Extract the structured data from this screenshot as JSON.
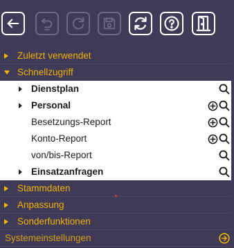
{
  "toolbar": {
    "buttons": [
      {
        "name": "back",
        "icon": "arrow-left-icon",
        "enabled": true
      },
      {
        "name": "undo",
        "icon": "undo-icon",
        "enabled": false
      },
      {
        "name": "redo",
        "icon": "redo-icon",
        "enabled": false
      },
      {
        "name": "save",
        "icon": "save-icon",
        "enabled": false
      },
      {
        "name": "refresh",
        "icon": "refresh-icon",
        "enabled": true
      },
      {
        "name": "help",
        "icon": "help-icon",
        "enabled": true
      },
      {
        "name": "exit",
        "icon": "exit-door-icon",
        "enabled": true
      }
    ]
  },
  "menu": {
    "recent": {
      "label": "Zuletzt verwendet",
      "expanded": false
    },
    "quick": {
      "label": "Schnellzugriff",
      "expanded": true,
      "items": [
        {
          "label": "Dienstplan",
          "has_children": true,
          "actions": [
            "search-icon"
          ]
        },
        {
          "label": "Personal",
          "has_children": true,
          "actions": [
            "add-circle-icon",
            "search-icon"
          ]
        },
        {
          "label": "Besetzungs-Report",
          "has_children": false,
          "actions": [
            "add-circle-icon",
            "search-icon"
          ]
        },
        {
          "label": "Konto-Report",
          "has_children": false,
          "actions": [
            "add-circle-icon",
            "search-icon"
          ]
        },
        {
          "label": "von/bis-Report",
          "has_children": false,
          "actions": [
            "search-icon"
          ]
        },
        {
          "label": "Einsatzanfragen",
          "has_children": true,
          "actions": [
            "search-icon"
          ]
        }
      ]
    },
    "master": {
      "label": "Stammdaten",
      "expanded": false
    },
    "adjust": {
      "label": "Anpassung",
      "expanded": false
    },
    "special": {
      "label": "Sonderfunktionen",
      "expanded": false
    },
    "system": {
      "label": "Systemeinstellungen",
      "icon": "arrow-right-circle-icon"
    }
  },
  "colors": {
    "background": "#3f3a57",
    "accent": "#f2b300",
    "submenu_bg": "#ffffff"
  }
}
